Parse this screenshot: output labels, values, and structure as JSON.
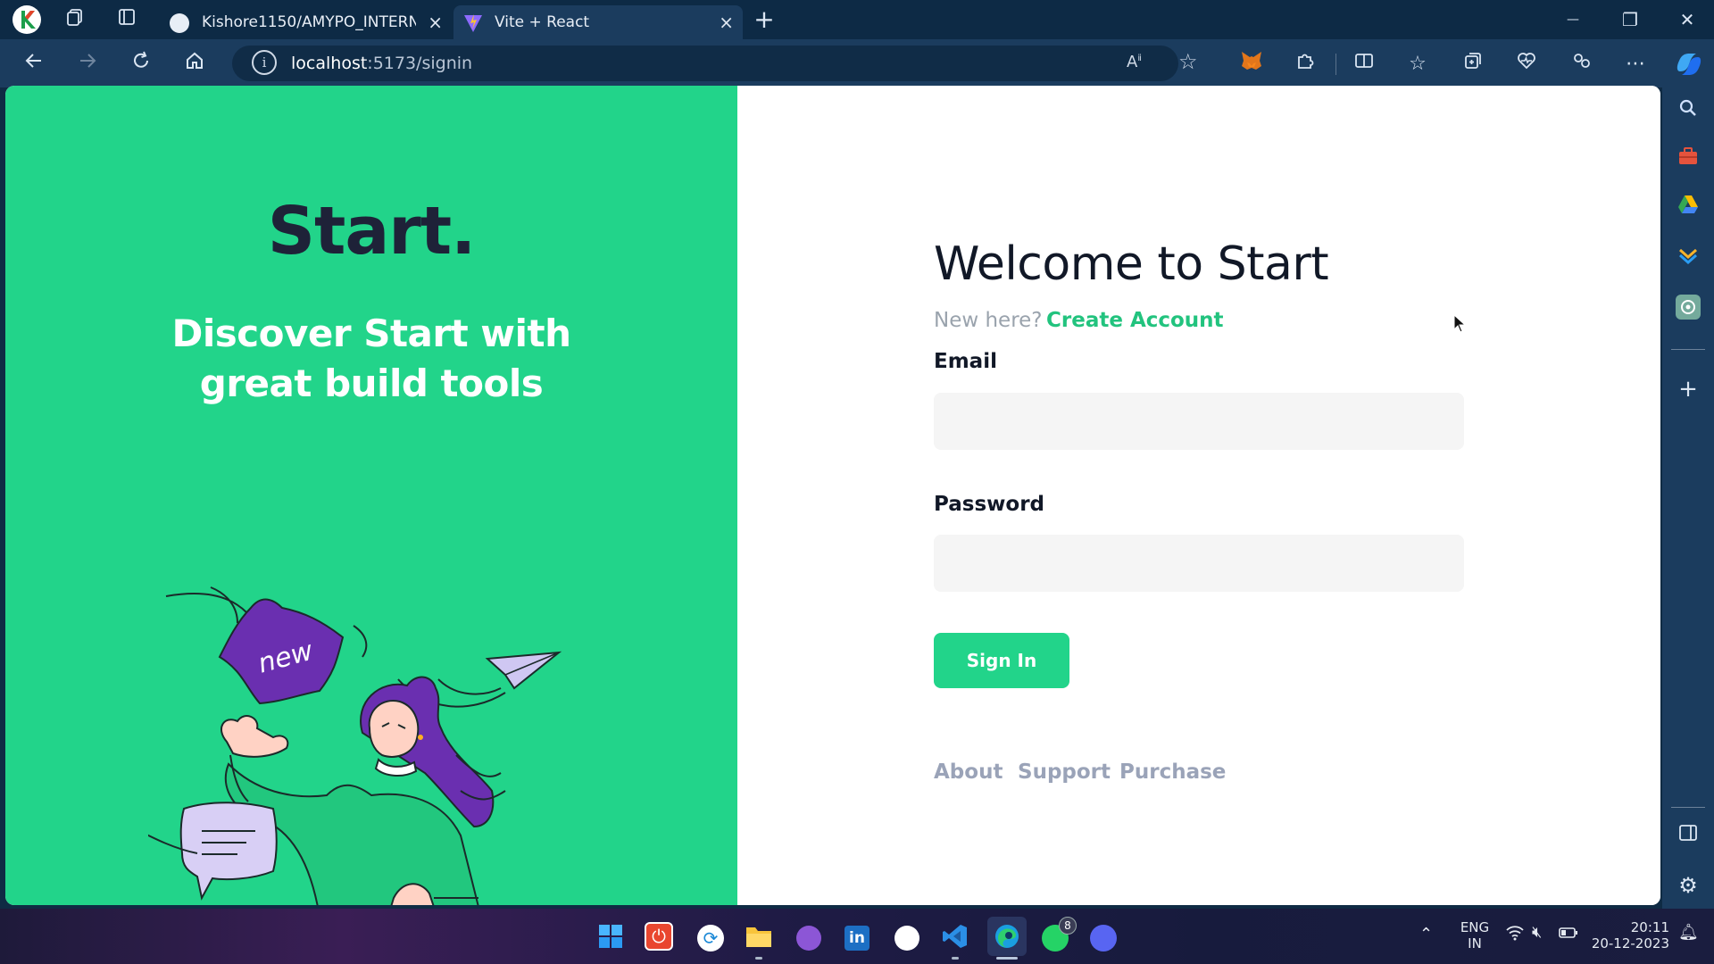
{
  "browser": {
    "tabs": [
      {
        "title": "Kishore1150/AMYPO_INTERNSHI",
        "close": "×"
      },
      {
        "title": "Vite + React",
        "close": "×"
      }
    ],
    "new_tab": "+",
    "url_host": "localhost",
    "url_path": ":5173/signin",
    "window_controls": {
      "minimize": "—",
      "restore": "❐",
      "close": "✕"
    }
  },
  "page": {
    "brand": "Start.",
    "tagline": "Discover Start with great build tools",
    "illustration_badge": "new",
    "welcome_title": "Welcome to Start",
    "new_here": "New here?",
    "create_account": "Create Account",
    "email_label": "Email",
    "email_value": "",
    "password_label": "Password",
    "password_value": "",
    "signin_button": "Sign In",
    "footer_links": [
      "About",
      "Support",
      "Purchase"
    ]
  },
  "taskbar": {
    "lang_top": "ENG",
    "lang_bottom": "IN",
    "time": "20:11",
    "date": "20-12-2023",
    "whatsapp_badge": "8"
  },
  "colors": {
    "accent_green": "#22d48a",
    "brand_dark": "#1e2238",
    "muted_link": "#9aa3b8"
  }
}
